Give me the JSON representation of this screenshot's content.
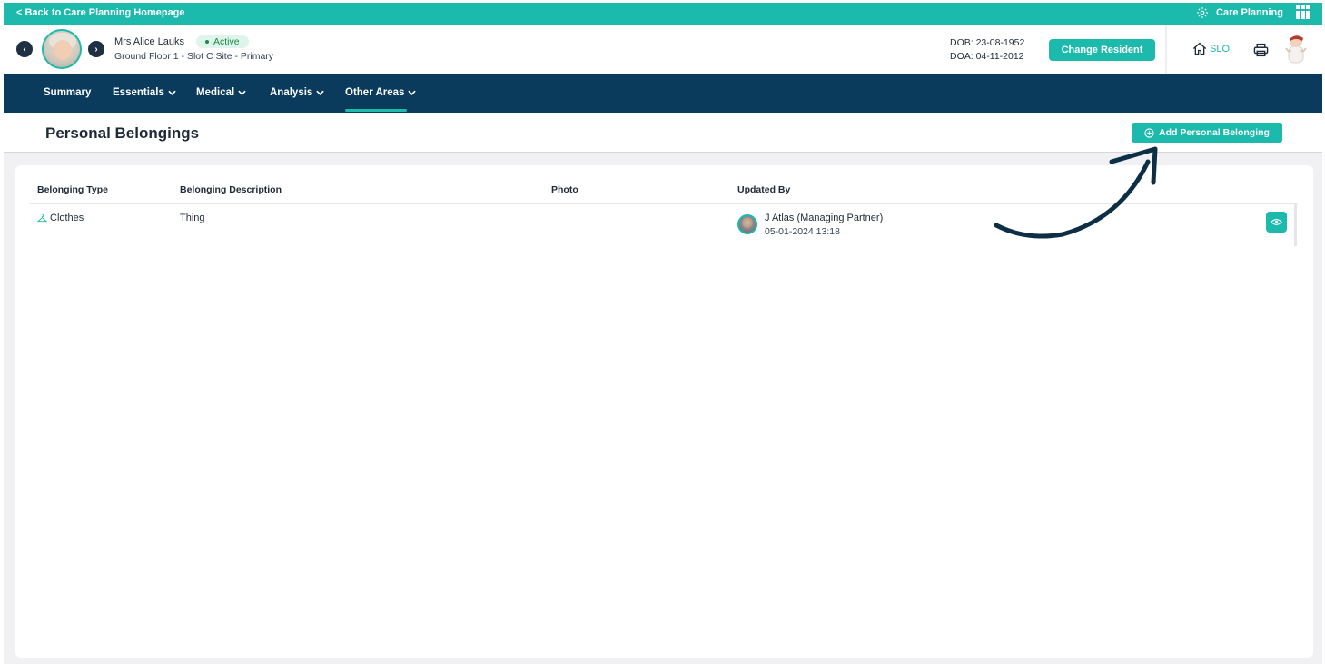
{
  "topbar": {
    "back_label": "< Back to Care Planning Homepage",
    "app_label": "Care Planning"
  },
  "resident": {
    "name": "Mrs Alice Lauks",
    "status": "Active",
    "location": "Ground Floor 1 - Slot C Site - Primary",
    "dob": "DOB: 23-08-1952",
    "doa": "DOA: 04-11-2012",
    "change_label": "Change Resident"
  },
  "header_actions": {
    "home_label": "SLO"
  },
  "nav": {
    "items": [
      {
        "label": "Summary"
      },
      {
        "label": "Essentials"
      },
      {
        "label": "Medical"
      },
      {
        "label": "Analysis"
      },
      {
        "label": "Other Areas"
      }
    ],
    "active": "Other Areas"
  },
  "page": {
    "title": "Personal Belongings",
    "add_label": "Add Personal Belonging"
  },
  "table": {
    "columns": [
      "Belonging Type",
      "Belonging Description",
      "Photo",
      "Updated By"
    ],
    "rows": [
      {
        "type": "Clothes",
        "description": "Thing",
        "photo": "",
        "updated_by": "J Atlas (Managing Partner)",
        "updated_at": "05-01-2024 13:18"
      }
    ]
  },
  "colors": {
    "teal": "#1cb9ad",
    "navy": "#0a3a5c",
    "arrow": "#0d2f45"
  }
}
